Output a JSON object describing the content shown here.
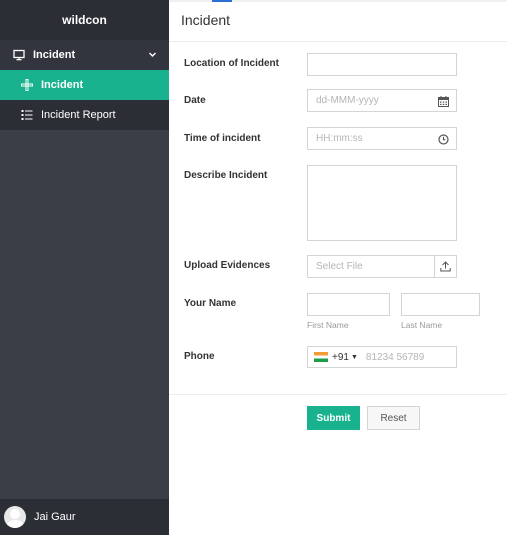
{
  "sidebar": {
    "brand": "wildcon",
    "group": {
      "label": "Incident",
      "icon": "monitor-icon"
    },
    "items": [
      {
        "label": "Incident",
        "icon": "plus-move-icon",
        "active": true
      },
      {
        "label": "Incident Report",
        "icon": "list-icon",
        "active": false
      }
    ],
    "user": {
      "name": "Jai Gaur"
    }
  },
  "main": {
    "title": "Incident"
  },
  "form": {
    "location_label": "Location of Incident",
    "date_label": "Date",
    "date_placeholder": "dd-MMM-yyyy",
    "time_label": "Time of incident",
    "time_placeholder": "HH:mm:ss",
    "describe_label": "Describe Incident",
    "upload_label": "Upload Evidences",
    "upload_placeholder": "Select File",
    "name_label": "Your Name",
    "first_name_hint": "First Name",
    "last_name_hint": "Last Name",
    "phone_label": "Phone",
    "phone_code": "+91",
    "phone_placeholder": "81234 56789",
    "submit_label": "Submit",
    "reset_label": "Reset"
  },
  "colors": {
    "accent": "#18b38e",
    "sidebar_bg": "#3b3d47",
    "sidebar_dark": "#2c2e36"
  }
}
